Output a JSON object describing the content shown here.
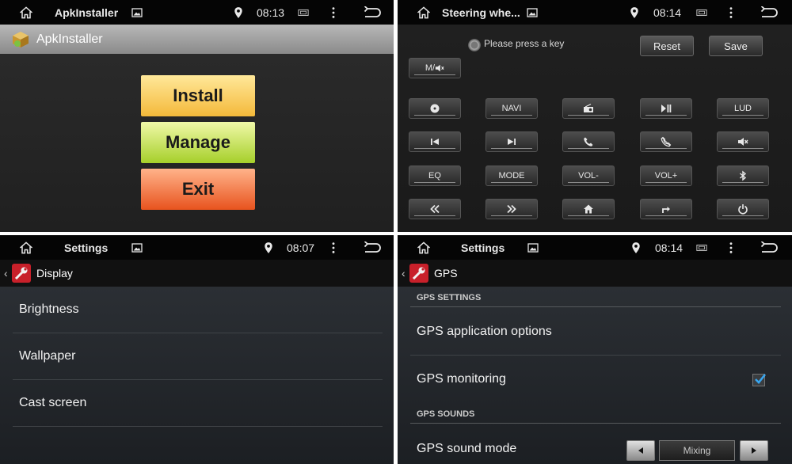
{
  "panels": {
    "apk": {
      "status": {
        "title": "ApkInstaller",
        "time": "08:13"
      },
      "appbar": {
        "title": "ApkInstaller"
      },
      "buttons": {
        "install": "Install",
        "manage": "Manage",
        "exit": "Exit"
      }
    },
    "steering": {
      "status": {
        "title": "Steering whe...",
        "time": "08:14"
      },
      "hint": "Please press a key",
      "reset": "Reset",
      "save": "Save",
      "keys": {
        "mute_mode": "M/",
        "navi": "NAVI",
        "lud": "LUD",
        "eq": "EQ",
        "mode": "MODE",
        "vol_minus": "VOL-",
        "vol_plus": "VOL+"
      }
    },
    "display": {
      "status": {
        "title": "Settings",
        "time": "08:07"
      },
      "subbar": {
        "title": "Display"
      },
      "items": [
        "Brightness",
        "Wallpaper",
        "Cast screen"
      ]
    },
    "gps": {
      "status": {
        "title": "Settings",
        "time": "08:14"
      },
      "subbar": {
        "title": "GPS"
      },
      "section_settings": "GPS SETTINGS",
      "app_options": "GPS application options",
      "monitoring": "GPS monitoring",
      "monitoring_checked": true,
      "section_sounds": "GPS SOUNDS",
      "sound_mode": "GPS sound mode",
      "sound_mode_value": "Mixing"
    }
  },
  "colors": {
    "status_bar": "#050505",
    "install": "#f4b93a",
    "manage": "#a6cf2a",
    "exit": "#e8531e",
    "check": "#38a6f0"
  }
}
